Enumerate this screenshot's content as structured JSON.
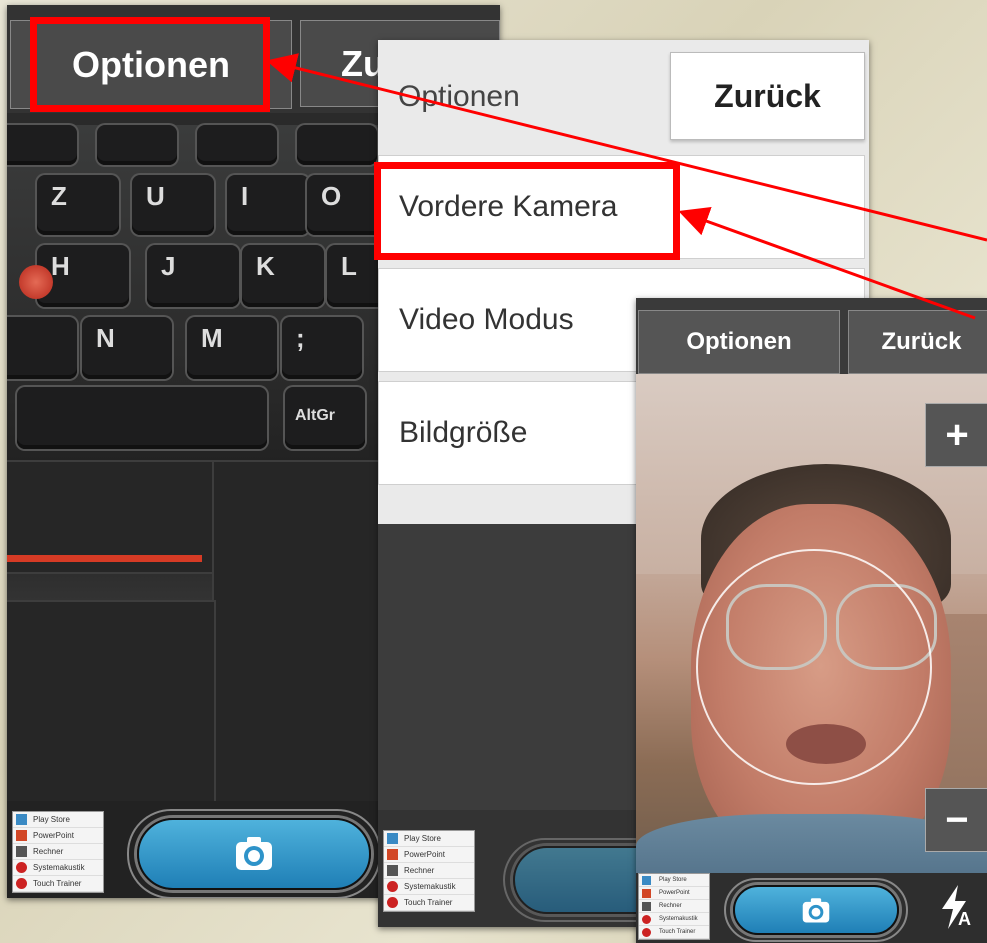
{
  "panel_keyboard": {
    "options_label": "Optionen",
    "back_label": "Zu",
    "keys": [
      "Z",
      "U",
      "I",
      "O",
      "H",
      "J",
      "K",
      "L",
      "N",
      "M",
      ";",
      "AltGr"
    ],
    "task_menu": [
      "Play Store",
      "PowerPoint",
      "Rechner",
      "Systemakustik",
      "Touch Trainer"
    ]
  },
  "panel_options": {
    "title": "Optionen",
    "back_label": "Zurück",
    "items": [
      "Vordere Kamera",
      "Video Modus",
      "Bildgröße"
    ],
    "task_menu": [
      "Play Store",
      "PowerPoint",
      "Rechner",
      "Systemakustik",
      "Touch Trainer"
    ]
  },
  "panel_selfie": {
    "options_label": "Optionen",
    "back_label": "Zurück",
    "zoom_in_label": "+",
    "zoom_out_label": "−",
    "flash_mode_label": "A",
    "task_menu": [
      "Play Store",
      "PowerPoint",
      "Rechner",
      "Systemakustik",
      "Touch Trainer"
    ]
  },
  "colors": {
    "highlight": "#ff0000",
    "shutter": "#2e93c9",
    "trackpoint": "#d4493a"
  }
}
